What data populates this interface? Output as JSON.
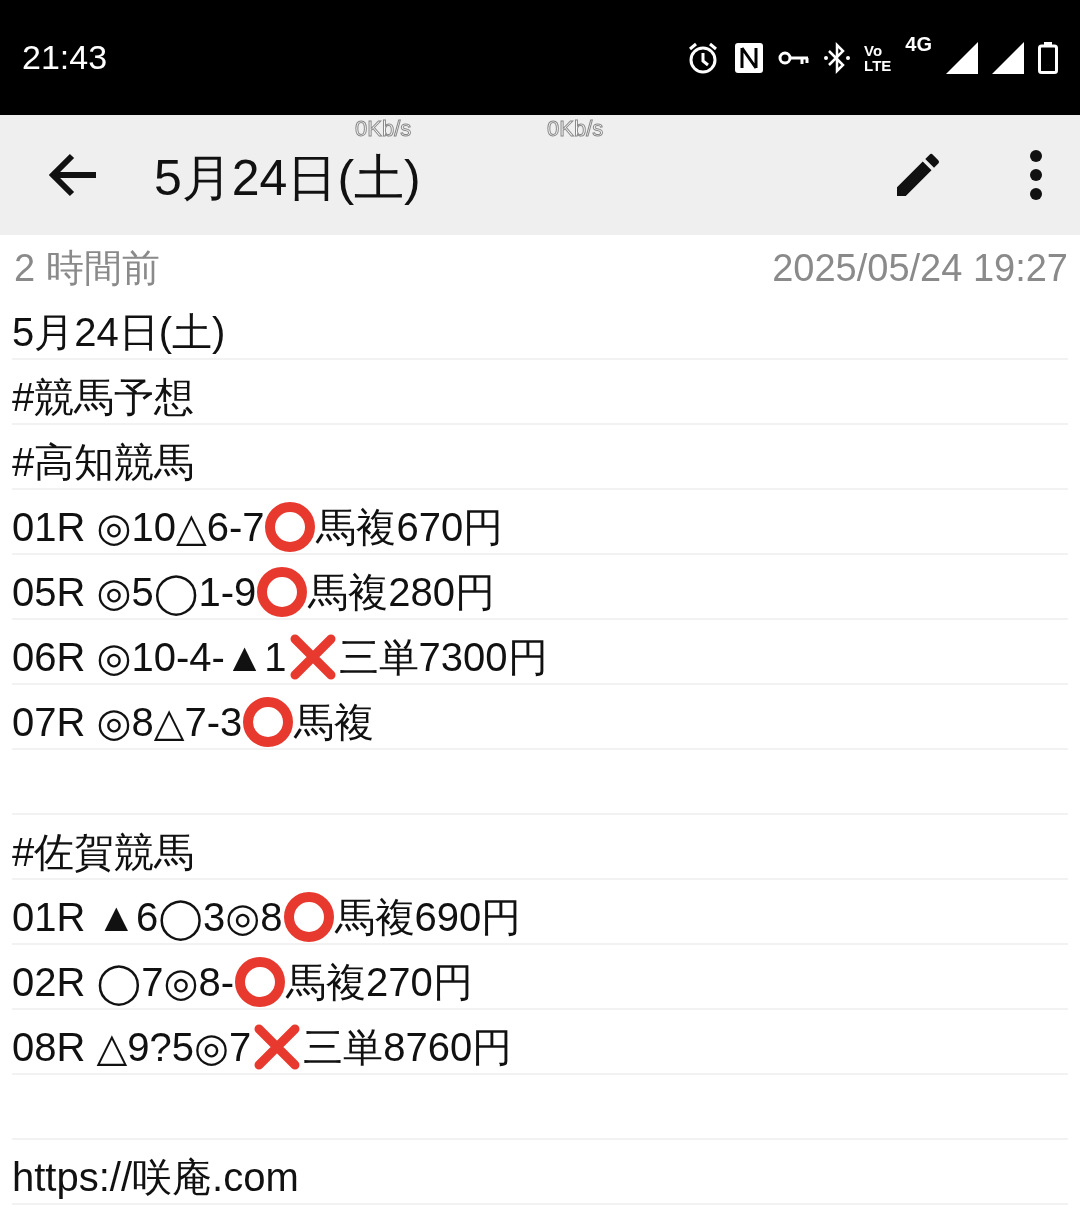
{
  "status_bar": {
    "time": "21:43",
    "volte_top": "Vo",
    "volte_bottom": "LTE",
    "network": "4G"
  },
  "toolbar": {
    "title": "5月24日(土)",
    "speed_overlays": [
      "0Kb/s",
      "0Kb/s"
    ]
  },
  "meta": {
    "relative_time": "2 時間前",
    "timestamp": "2025/05/24 19:27"
  },
  "lines": [
    {
      "kind": "text",
      "parts": [
        {
          "kind": "text",
          "text": "5月24日(土)"
        }
      ]
    },
    {
      "kind": "text",
      "parts": [
        {
          "kind": "text",
          "text": "#競馬予想"
        }
      ]
    },
    {
      "kind": "text",
      "parts": [
        {
          "kind": "text",
          "text": "#高知競馬"
        }
      ]
    },
    {
      "kind": "text",
      "parts": [
        {
          "kind": "text",
          "text": "01R ◎10△6-7"
        },
        {
          "kind": "hit"
        },
        {
          "kind": "text",
          "text": "馬複670円"
        }
      ]
    },
    {
      "kind": "text",
      "parts": [
        {
          "kind": "text",
          "text": "05R ◎5◯1-9"
        },
        {
          "kind": "hit"
        },
        {
          "kind": "text",
          "text": "馬複280円"
        }
      ]
    },
    {
      "kind": "text",
      "parts": [
        {
          "kind": "text",
          "text": "06R ◎10-4-▲1"
        },
        {
          "kind": "miss"
        },
        {
          "kind": "text",
          "text": "三単7300円"
        }
      ]
    },
    {
      "kind": "text",
      "parts": [
        {
          "kind": "text",
          "text": "07R ◎8△7-3"
        },
        {
          "kind": "hit"
        },
        {
          "kind": "text",
          "text": "馬複"
        }
      ]
    },
    {
      "kind": "blank"
    },
    {
      "kind": "text",
      "parts": [
        {
          "kind": "text",
          "text": "#佐賀競馬"
        }
      ]
    },
    {
      "kind": "text",
      "parts": [
        {
          "kind": "text",
          "text": "01R ▲6◯3◎8"
        },
        {
          "kind": "hit"
        },
        {
          "kind": "text",
          "text": "馬複690円"
        }
      ]
    },
    {
      "kind": "text",
      "parts": [
        {
          "kind": "text",
          "text": "02R ◯7◎8-"
        },
        {
          "kind": "hit"
        },
        {
          "kind": "text",
          "text": "馬複270円"
        }
      ]
    },
    {
      "kind": "text",
      "parts": [
        {
          "kind": "text",
          "text": "08R △9?5◎7"
        },
        {
          "kind": "miss"
        },
        {
          "kind": "text",
          "text": "三単8760円"
        }
      ]
    },
    {
      "kind": "blank"
    },
    {
      "kind": "text",
      "parts": [
        {
          "kind": "text",
          "text": "https://咲庵.com"
        }
      ]
    }
  ]
}
